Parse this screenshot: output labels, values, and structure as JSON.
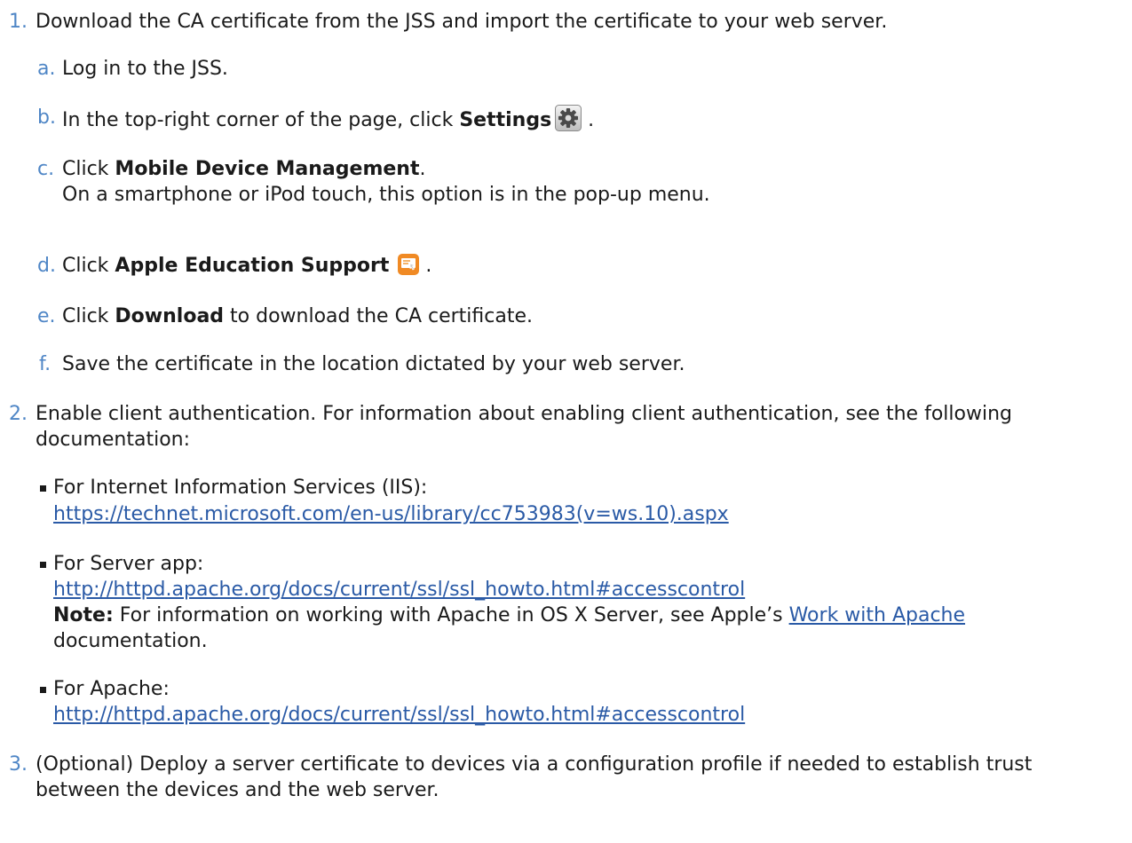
{
  "step1": {
    "num": "1.",
    "text": "Download the CA certificate from the JSS and import the certificate to your web server.",
    "substeps": {
      "a": {
        "marker": "a.",
        "text": "Log in to the JSS."
      },
      "b": {
        "marker": "b.",
        "pre": "In the top-right corner of the page, click ",
        "bold": "Settings",
        "post": " .",
        "icon": "gear-icon"
      },
      "c": {
        "marker": "c.",
        "pre": "Click ",
        "bold": "Mobile Device Management",
        "post": ".",
        "line2": "On a smartphone or iPod touch, this option is in the pop-up menu."
      },
      "d": {
        "marker": "d.",
        "pre": "Click ",
        "bold": "Apple Education Support",
        "post": " .",
        "icon": "apple-education-support-icon"
      },
      "e": {
        "marker": "e.",
        "pre": "Click ",
        "bold": "Download",
        "post": " to download the CA certificate."
      },
      "f": {
        "marker": "f.",
        "text": "Save the certificate in the location dictated by your web server."
      }
    }
  },
  "step2": {
    "num": "2.",
    "line1": "Enable client authentication. For information about enabling client authentication, see the following",
    "line2": "documentation:",
    "bullets": [
      {
        "label": "For Internet Information Services (IIS):",
        "url": "https://technet.microsoft.com/en-us/library/cc753983(v=ws.10).aspx"
      },
      {
        "label": "For Server app:",
        "url": "http://httpd.apache.org/docs/current/ssl/ssl_howto.html#accesscontrol",
        "note_bold": "Note:",
        "note_pre": " For information on working with Apache in OS X Server, see Apple’s ",
        "note_link": "Work with Apache",
        "note_post": "documentation."
      },
      {
        "label": "For Apache:",
        "url": "http://httpd.apache.org/docs/current/ssl/ssl_howto.html#accesscontrol"
      }
    ]
  },
  "step3": {
    "num": "3.",
    "line1": "(Optional) Deploy a server certificate to devices via a configuration profile if needed to establish trust",
    "line2": "between the devices and the web server."
  },
  "colors": {
    "marker": "#4f86c6",
    "link": "#2a5aa6",
    "text": "#1a1a1a"
  }
}
